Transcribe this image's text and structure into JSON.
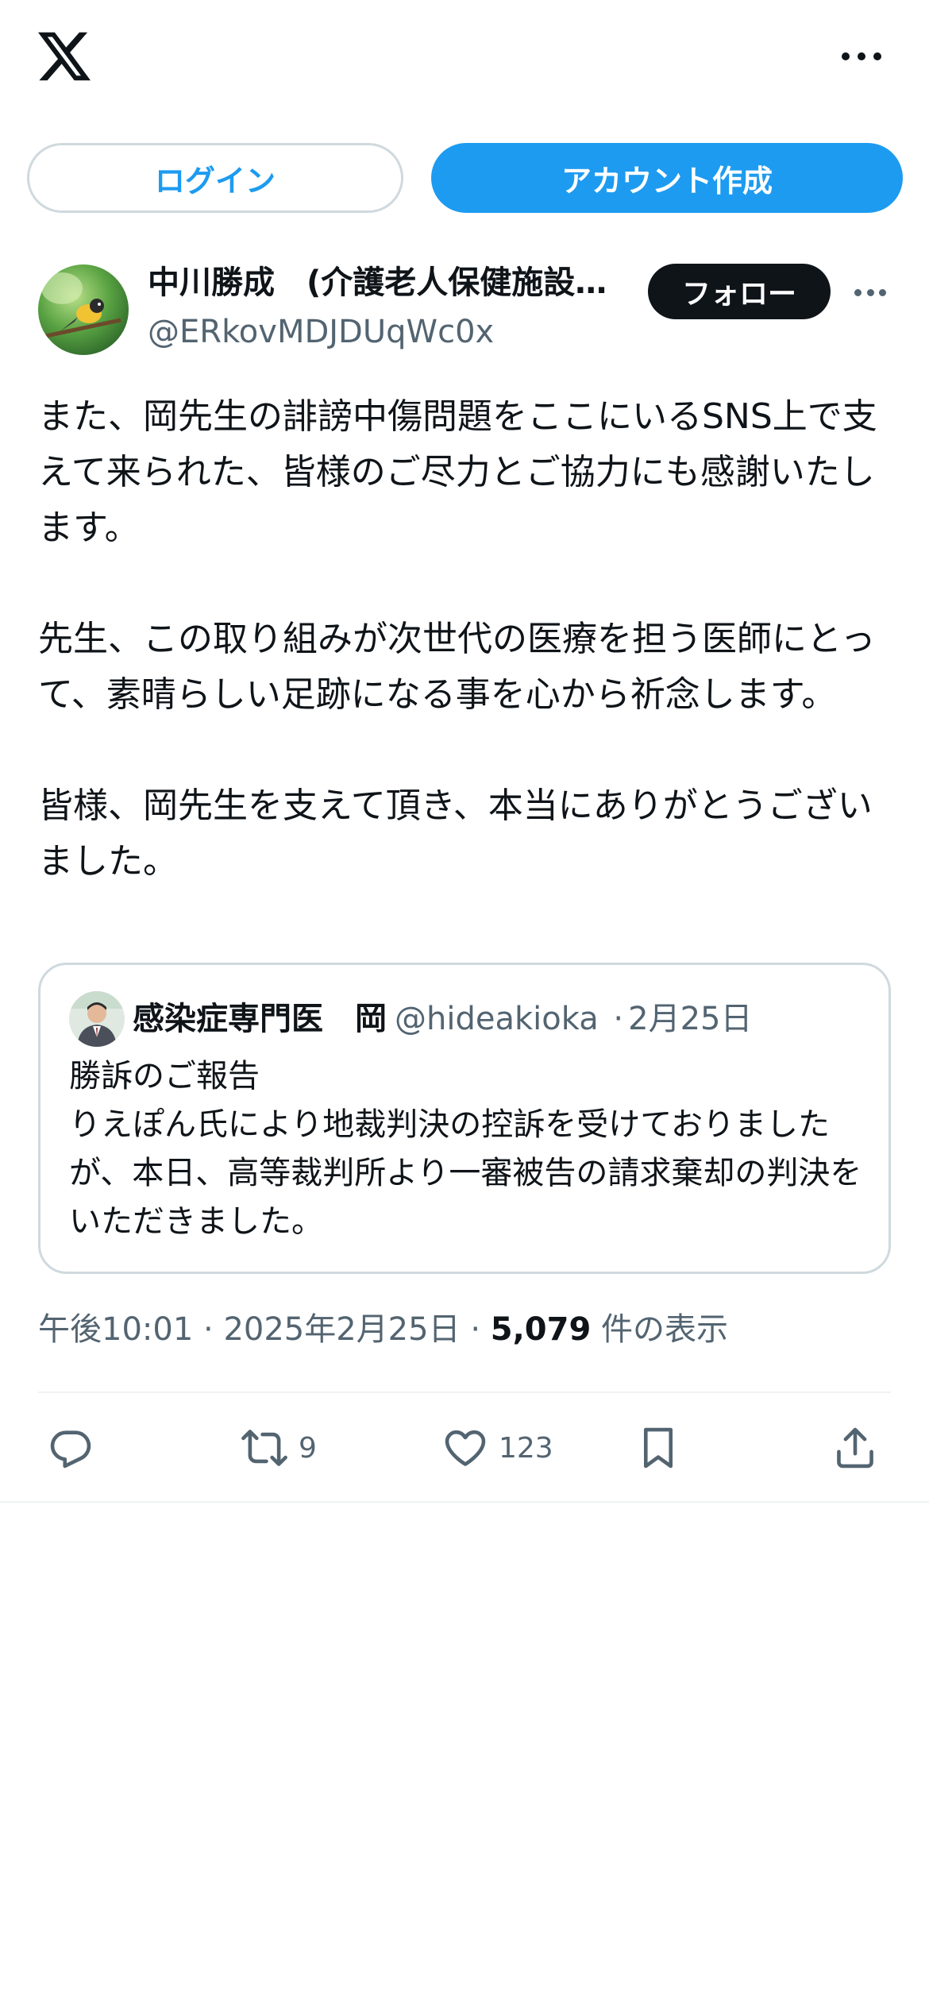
{
  "header": {
    "logo_icon": "x-logo-icon",
    "more_icon": "more-horizontal-icon"
  },
  "auth": {
    "login_label": "ログイン",
    "signup_label": "アカウント作成"
  },
  "tweet": {
    "author_name": "中川勝成　(介護老人保健施設...",
    "author_handle": "@ERkovMDJDUqWc0x",
    "follow_label": "フォロー",
    "paragraphs": [
      "また、岡先生の誹謗中傷問題をここにいるSNS上で支えて来られた、皆様のご尽力とご協力にも感謝いたします。",
      "先生、この取り組みが次世代の医療を担う医師にとって、素晴らしい足跡になる事を心から祈念します。",
      "皆様、岡先生を支えて頂き、本当にありがとうございました。"
    ],
    "quote": {
      "name": "感染症専門医　岡",
      "handle": "@hideakioka",
      "separator": "·",
      "date": "2月25日",
      "lines": [
        "勝訴のご報告",
        "りえぽん氏により地裁判決の控訴を受けておりましたが、本日、高等裁判所より一審被告の請求棄却の判決をいただきました。"
      ]
    },
    "meta": {
      "time": "午後10:01",
      "separator": "·",
      "date": "2025年2月25日",
      "views_count": "5,079",
      "views_label": "件の表示"
    },
    "actions": {
      "reply_icon": "reply-icon",
      "retweet_icon": "retweet-icon",
      "retweet_count": "9",
      "like_icon": "heart-icon",
      "like_count": "123",
      "bookmark_icon": "bookmark-icon",
      "share_icon": "share-icon"
    }
  },
  "colors": {
    "accent": "#1d9bf0",
    "text": "#0f1419",
    "secondary": "#536471",
    "border": "#cfd9de"
  }
}
